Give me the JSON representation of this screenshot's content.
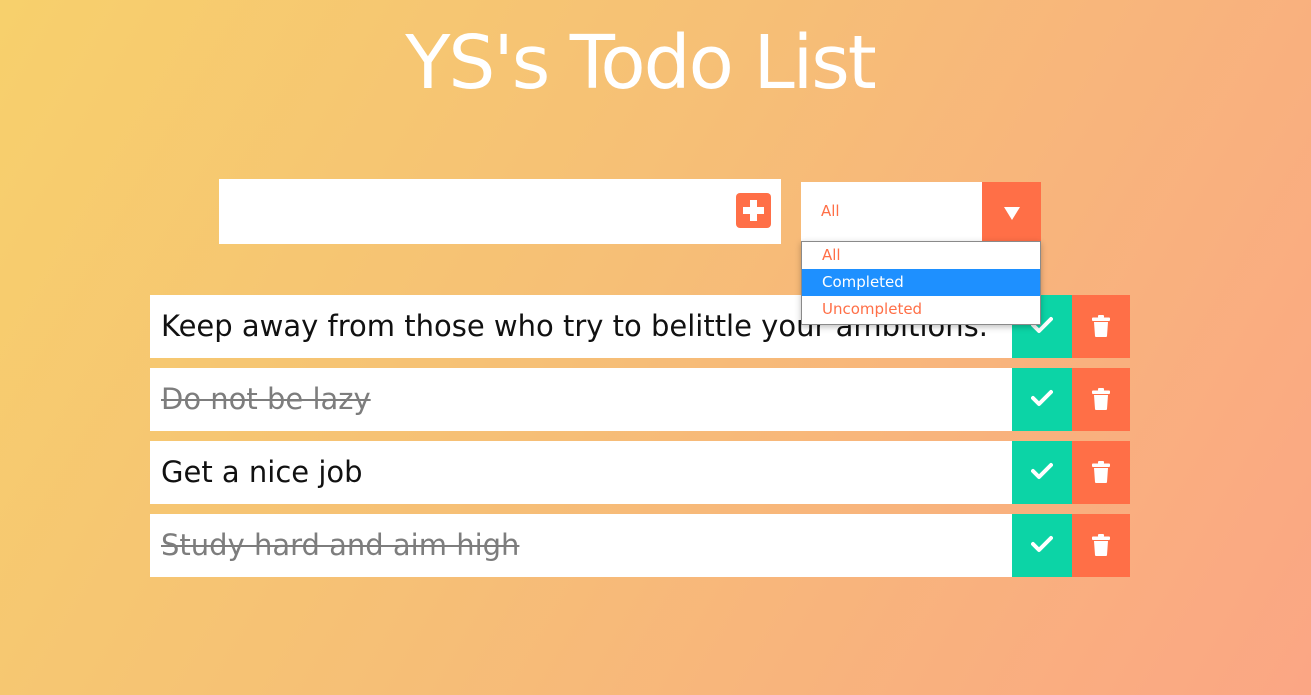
{
  "header": {
    "title": "YS's Todo List"
  },
  "todo_input": {
    "value": "",
    "placeholder": "",
    "add_icon": "plus-square-icon"
  },
  "filter": {
    "selected_label": "All",
    "arrow_icon": "caret-down-icon",
    "options": [
      {
        "label": "All",
        "highlighted": false
      },
      {
        "label": "Completed",
        "highlighted": true
      },
      {
        "label": "Uncompleted",
        "highlighted": false
      }
    ]
  },
  "todos": [
    {
      "text": "Keep away from those who try to belittle your ambitions.",
      "completed": false
    },
    {
      "text": "Do not be lazy",
      "completed": true
    },
    {
      "text": "Get a nice job",
      "completed": false
    },
    {
      "text": "Study hard and aim high",
      "completed": true
    }
  ],
  "colors": {
    "accent": "#ff6f47",
    "check": "#0cd4a6",
    "highlight": "#1e90ff",
    "gradient_start": "#f7d06c",
    "gradient_end": "#fba684"
  }
}
